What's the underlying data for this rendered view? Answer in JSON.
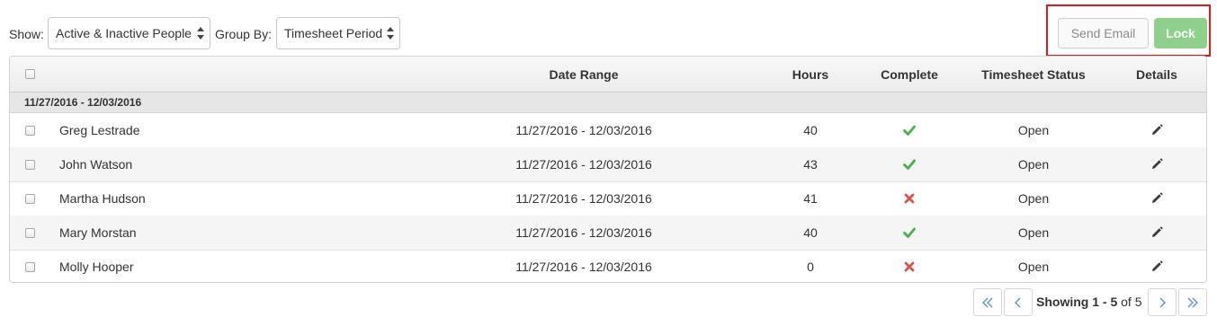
{
  "filters": {
    "show_label": "Show:",
    "show_value": "Active & Inactive People",
    "group_label": "Group By:",
    "group_value": "Timesheet Period"
  },
  "actions": {
    "send_email_label": "Send Email",
    "lock_label": "Lock"
  },
  "table": {
    "columns": {
      "date_range": "Date Range",
      "hours": "Hours",
      "complete": "Complete",
      "status": "Timesheet Status",
      "details": "Details"
    },
    "group": "11/27/2016 - 12/03/2016",
    "rows": [
      {
        "name": "Greg Lestrade",
        "date_range": "11/27/2016 - 12/03/2016",
        "hours": "40",
        "complete": true,
        "status": "Open"
      },
      {
        "name": "John Watson",
        "date_range": "11/27/2016 - 12/03/2016",
        "hours": "43",
        "complete": true,
        "status": "Open"
      },
      {
        "name": "Martha Hudson",
        "date_range": "11/27/2016 - 12/03/2016",
        "hours": "41",
        "complete": false,
        "status": "Open"
      },
      {
        "name": "Mary Morstan",
        "date_range": "11/27/2016 - 12/03/2016",
        "hours": "40",
        "complete": true,
        "status": "Open"
      },
      {
        "name": "Molly Hooper",
        "date_range": "11/27/2016 - 12/03/2016",
        "hours": "0",
        "complete": false,
        "status": "Open"
      }
    ]
  },
  "pagination": {
    "showing_prefix": "Showing",
    "range": "1 - 5",
    "of_text": "of 5"
  },
  "colors": {
    "lock_green": "#8fd08c",
    "check_green": "#4cae4c",
    "cross_red": "#d9534f",
    "highlight_red": "#e0191e"
  },
  "icons": {
    "complete_true": "check-icon",
    "complete_false": "cross-icon",
    "details": "pencil-icon"
  }
}
